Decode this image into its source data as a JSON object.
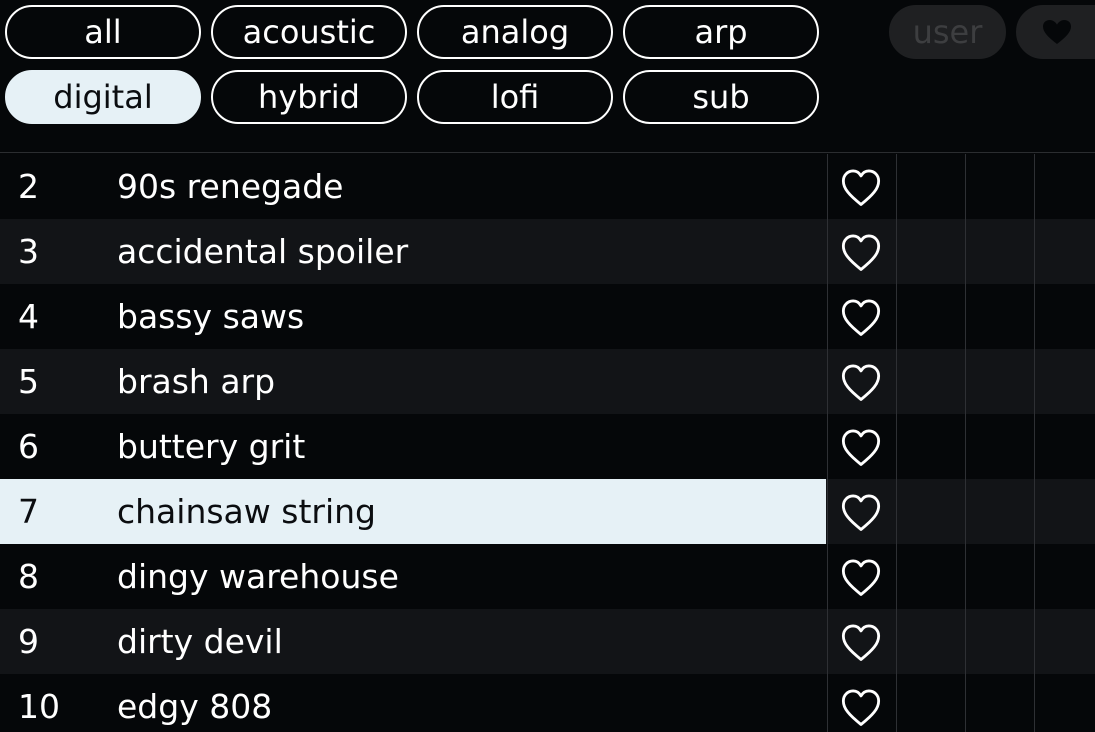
{
  "filters": {
    "tags": [
      {
        "label": "all",
        "active": false
      },
      {
        "label": "acoustic",
        "active": false
      },
      {
        "label": "analog",
        "active": false
      },
      {
        "label": "arp",
        "active": false
      },
      {
        "label": "digital",
        "active": true
      },
      {
        "label": "hybrid",
        "active": false
      },
      {
        "label": "lofi",
        "active": false
      },
      {
        "label": "sub",
        "active": false
      }
    ],
    "user_label": "user",
    "favorites_icon": "heart-filled-icon"
  },
  "presets": [
    {
      "number": "2",
      "name": "90s renegade",
      "selected": false,
      "favorite_icon": "heart-outline-icon"
    },
    {
      "number": "3",
      "name": "accidental spoiler",
      "selected": false,
      "favorite_icon": "heart-outline-icon"
    },
    {
      "number": "4",
      "name": "bassy saws",
      "selected": false,
      "favorite_icon": "heart-outline-icon"
    },
    {
      "number": "5",
      "name": "brash arp",
      "selected": false,
      "favorite_icon": "heart-outline-icon"
    },
    {
      "number": "6",
      "name": "buttery grit",
      "selected": false,
      "favorite_icon": "heart-outline-icon"
    },
    {
      "number": "7",
      "name": "chainsaw string",
      "selected": true,
      "favorite_icon": "heart-outline-icon"
    },
    {
      "number": "8",
      "name": "dingy warehouse",
      "selected": false,
      "favorite_icon": "heart-outline-icon"
    },
    {
      "number": "9",
      "name": "dirty devil",
      "selected": false,
      "favorite_icon": "heart-outline-icon"
    },
    {
      "number": "10",
      "name": "edgy 808",
      "selected": false,
      "favorite_icon": "heart-outline-icon"
    }
  ],
  "colors": {
    "background": "#050709",
    "row_alt": "#121417",
    "selected": "#e6f1f6",
    "ghost_chip": "#1f2022",
    "ghost_text": "#3d3e40"
  }
}
